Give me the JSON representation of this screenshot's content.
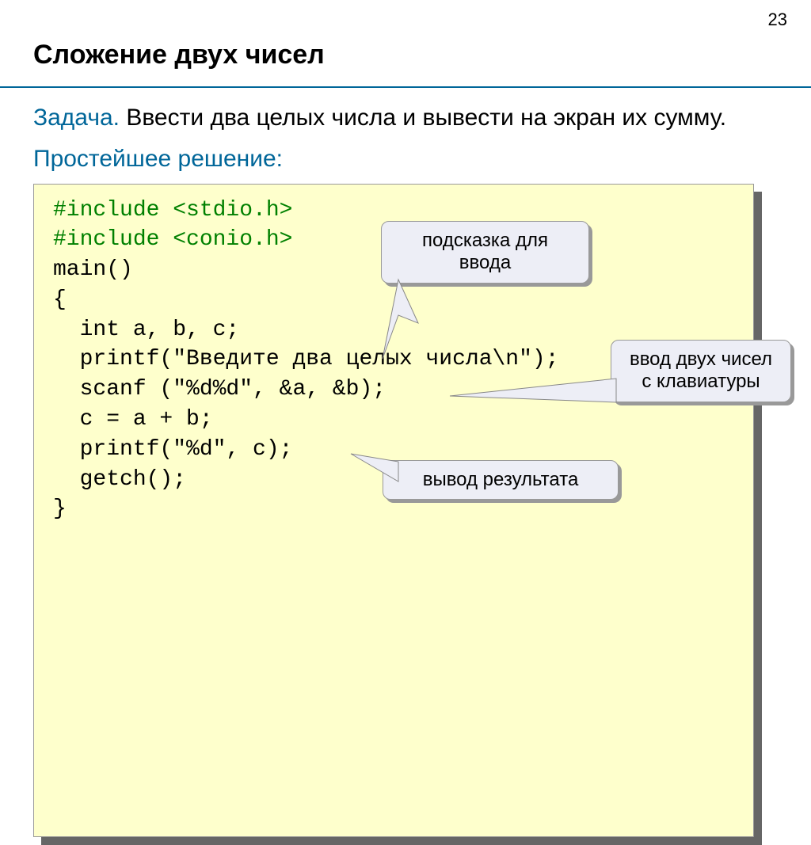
{
  "page_number": "23",
  "title": "Сложение двух чисел",
  "task_label": "Задача.",
  "task_text": " Ввести два целых числа и вывести на экран их сумму.",
  "solution_label": "Простейшее решение:",
  "code": {
    "l1": "#include <stdio.h>",
    "l2": "#include <conio.h>",
    "l3": "main()",
    "l4": "{",
    "l5": "  int a, b, c;",
    "l6": "  printf(\"Введите два целых числа\\n\");",
    "l7": "  scanf (\"%d%d\", &a, &b);",
    "l8": "  c = a + b;",
    "l9": "  printf(\"%d\", c);",
    "l10": "  getch();",
    "l11": "}"
  },
  "callouts": {
    "c1": "подсказка для ввода",
    "c2": "ввод двух чисел с клавиатуры",
    "c3": "вывод результата"
  }
}
